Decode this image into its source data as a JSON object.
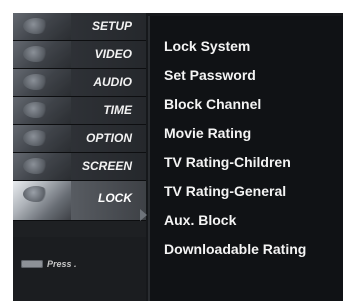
{
  "categories": [
    {
      "label": "SETUP"
    },
    {
      "label": "VIDEO"
    },
    {
      "label": "AUDIO"
    },
    {
      "label": "TIME"
    },
    {
      "label": "OPTION"
    },
    {
      "label": "SCREEN"
    },
    {
      "label": "LOCK",
      "active": true
    }
  ],
  "options": [
    {
      "label": "Lock System"
    },
    {
      "label": "Set Password"
    },
    {
      "label": "Block Channel"
    },
    {
      "label": "Movie Rating"
    },
    {
      "label": "TV Rating-Children"
    },
    {
      "label": "TV Rating-General"
    },
    {
      "label": "Aux. Block"
    },
    {
      "label": "Downloadable Rating"
    }
  ],
  "hint": {
    "text": "Press ."
  }
}
